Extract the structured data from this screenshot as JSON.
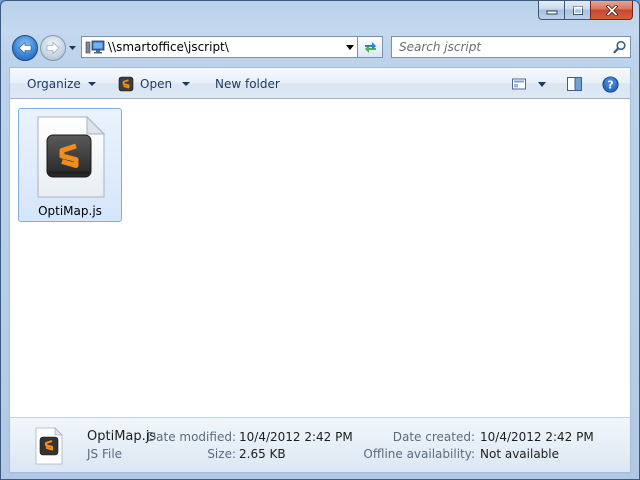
{
  "window": {
    "caption_buttons": [
      "minimize",
      "maximize",
      "close"
    ]
  },
  "navigation": {
    "address_path": "\\\\smartoffice\\jscript\\",
    "search_placeholder": "Search jscript"
  },
  "toolbar": {
    "organize_label": "Organize",
    "open_label": "Open",
    "new_folder_label": "New folder"
  },
  "files": [
    {
      "name": "OptiMap.js",
      "icon": "sublime-text-file-icon",
      "selected": true
    }
  ],
  "details": {
    "file_name": "OptiMap.js",
    "file_type": "JS File",
    "date_modified_label": "Date modified:",
    "date_modified_value": "10/4/2012 2:42 PM",
    "size_label": "Size:",
    "size_value": "2.65 KB",
    "date_created_label": "Date created:",
    "date_created_value": "10/4/2012 2:42 PM",
    "offline_label": "Offline availability:",
    "offline_value": "Not available"
  },
  "colors": {
    "accent": "#1e395b",
    "selection_border": "#84acdd",
    "sublime_orange": "#f28c1c"
  }
}
